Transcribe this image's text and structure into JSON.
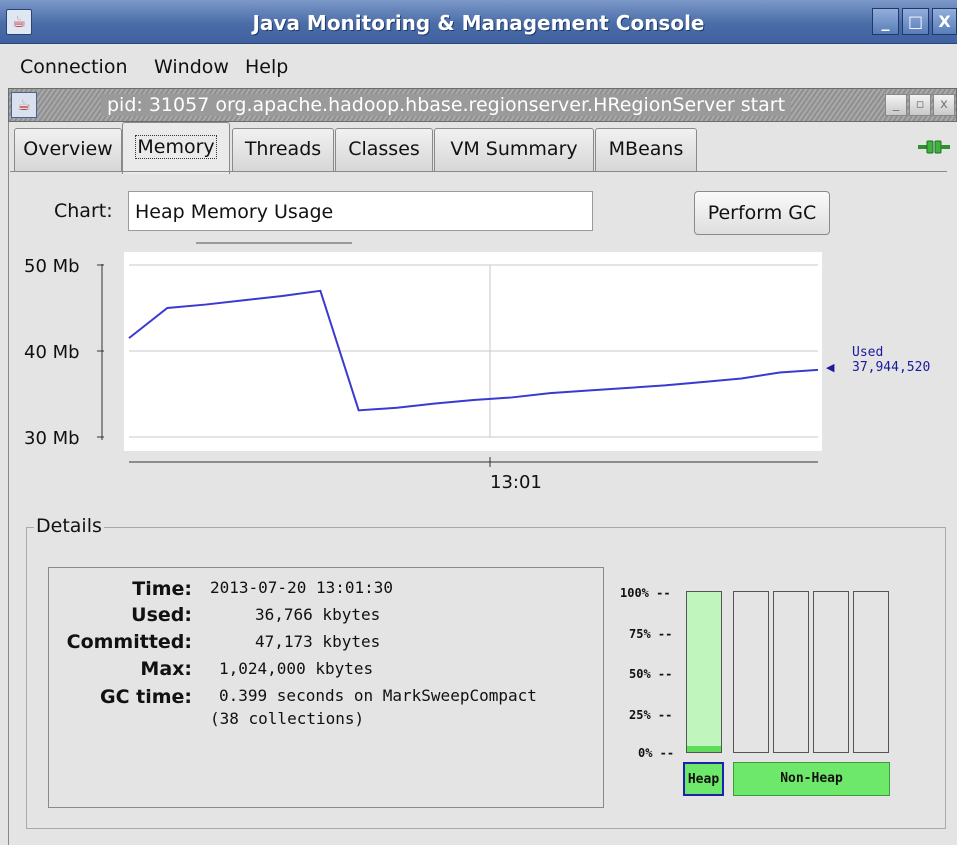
{
  "window": {
    "title": "Java Monitoring & Management Console",
    "icon": "java-cup-icon",
    "buttons": [
      "_",
      "□",
      "X"
    ]
  },
  "menubar": {
    "items": [
      "Connection",
      "Window",
      "Help"
    ]
  },
  "internal_frame": {
    "title": "pid: 31057 org.apache.hadoop.hbase.regionserver.HRegionServer start",
    "buttons": [
      "_",
      "▫",
      "x"
    ]
  },
  "tabs": [
    {
      "label": "Overview"
    },
    {
      "label": "Memory",
      "active": true
    },
    {
      "label": "Threads"
    },
    {
      "label": "Classes"
    },
    {
      "label": "VM Summary"
    },
    {
      "label": "MBeans"
    }
  ],
  "connection_icon": "connected-plug-icon",
  "chart_selector": {
    "label": "Chart:",
    "value": "Heap Memory Usage"
  },
  "perform_gc_label": "Perform GC",
  "chart_data": {
    "type": "line",
    "series": [
      {
        "name": "Used",
        "color": "#3a3ad0",
        "points": [
          {
            "t": 0,
            "mb": 41.5
          },
          {
            "t": 1,
            "mb": 45.0
          },
          {
            "t": 2,
            "mb": 45.4
          },
          {
            "t": 3,
            "mb": 45.9
          },
          {
            "t": 4,
            "mb": 46.4
          },
          {
            "t": 5,
            "mb": 47.0
          },
          {
            "t": 6,
            "mb": 33.1
          },
          {
            "t": 7,
            "mb": 33.4
          },
          {
            "t": 8,
            "mb": 33.9
          },
          {
            "t": 9,
            "mb": 34.3
          },
          {
            "t": 10,
            "mb": 34.6
          },
          {
            "t": 11,
            "mb": 35.1
          },
          {
            "t": 12,
            "mb": 35.4
          },
          {
            "t": 13,
            "mb": 35.7
          },
          {
            "t": 14,
            "mb": 36.0
          },
          {
            "t": 15,
            "mb": 36.4
          },
          {
            "t": 16,
            "mb": 36.8
          },
          {
            "t": 17,
            "mb": 37.5
          },
          {
            "t": 18,
            "mb": 37.8
          }
        ]
      }
    ],
    "t_range": [
      0,
      18
    ],
    "ylim": [
      30,
      50
    ],
    "y_ticks": [
      "50 Mb",
      "40 Mb",
      "30 Mb"
    ],
    "x_tick": "13:01",
    "grid": true,
    "current_label": "Used",
    "current_value": "37,944,520"
  },
  "details": {
    "title": "Details",
    "labels": {
      "time": "Time:",
      "used": "Used:",
      "committed": "Committed:",
      "max": "Max:",
      "gc_time": "GC time:"
    },
    "values": {
      "time": "2013-07-20 13:01:30",
      "used": "36,766 kbytes",
      "committed": "47,173 kbytes",
      "max": "1,024,000 kbytes",
      "gc_time": "0.399  seconds on MarkSweepCompact",
      "gc_collections": "(38 collections)"
    }
  },
  "pools": {
    "percent_ticks": [
      "100% --",
      "75% --",
      "50% --",
      "25% --",
      "0% --"
    ],
    "heap": {
      "label": "Heap",
      "committed_fraction": 1.0,
      "used_fraction": 0.04
    },
    "non_heap": {
      "label": "Non-Heap",
      "count": 4
    }
  }
}
